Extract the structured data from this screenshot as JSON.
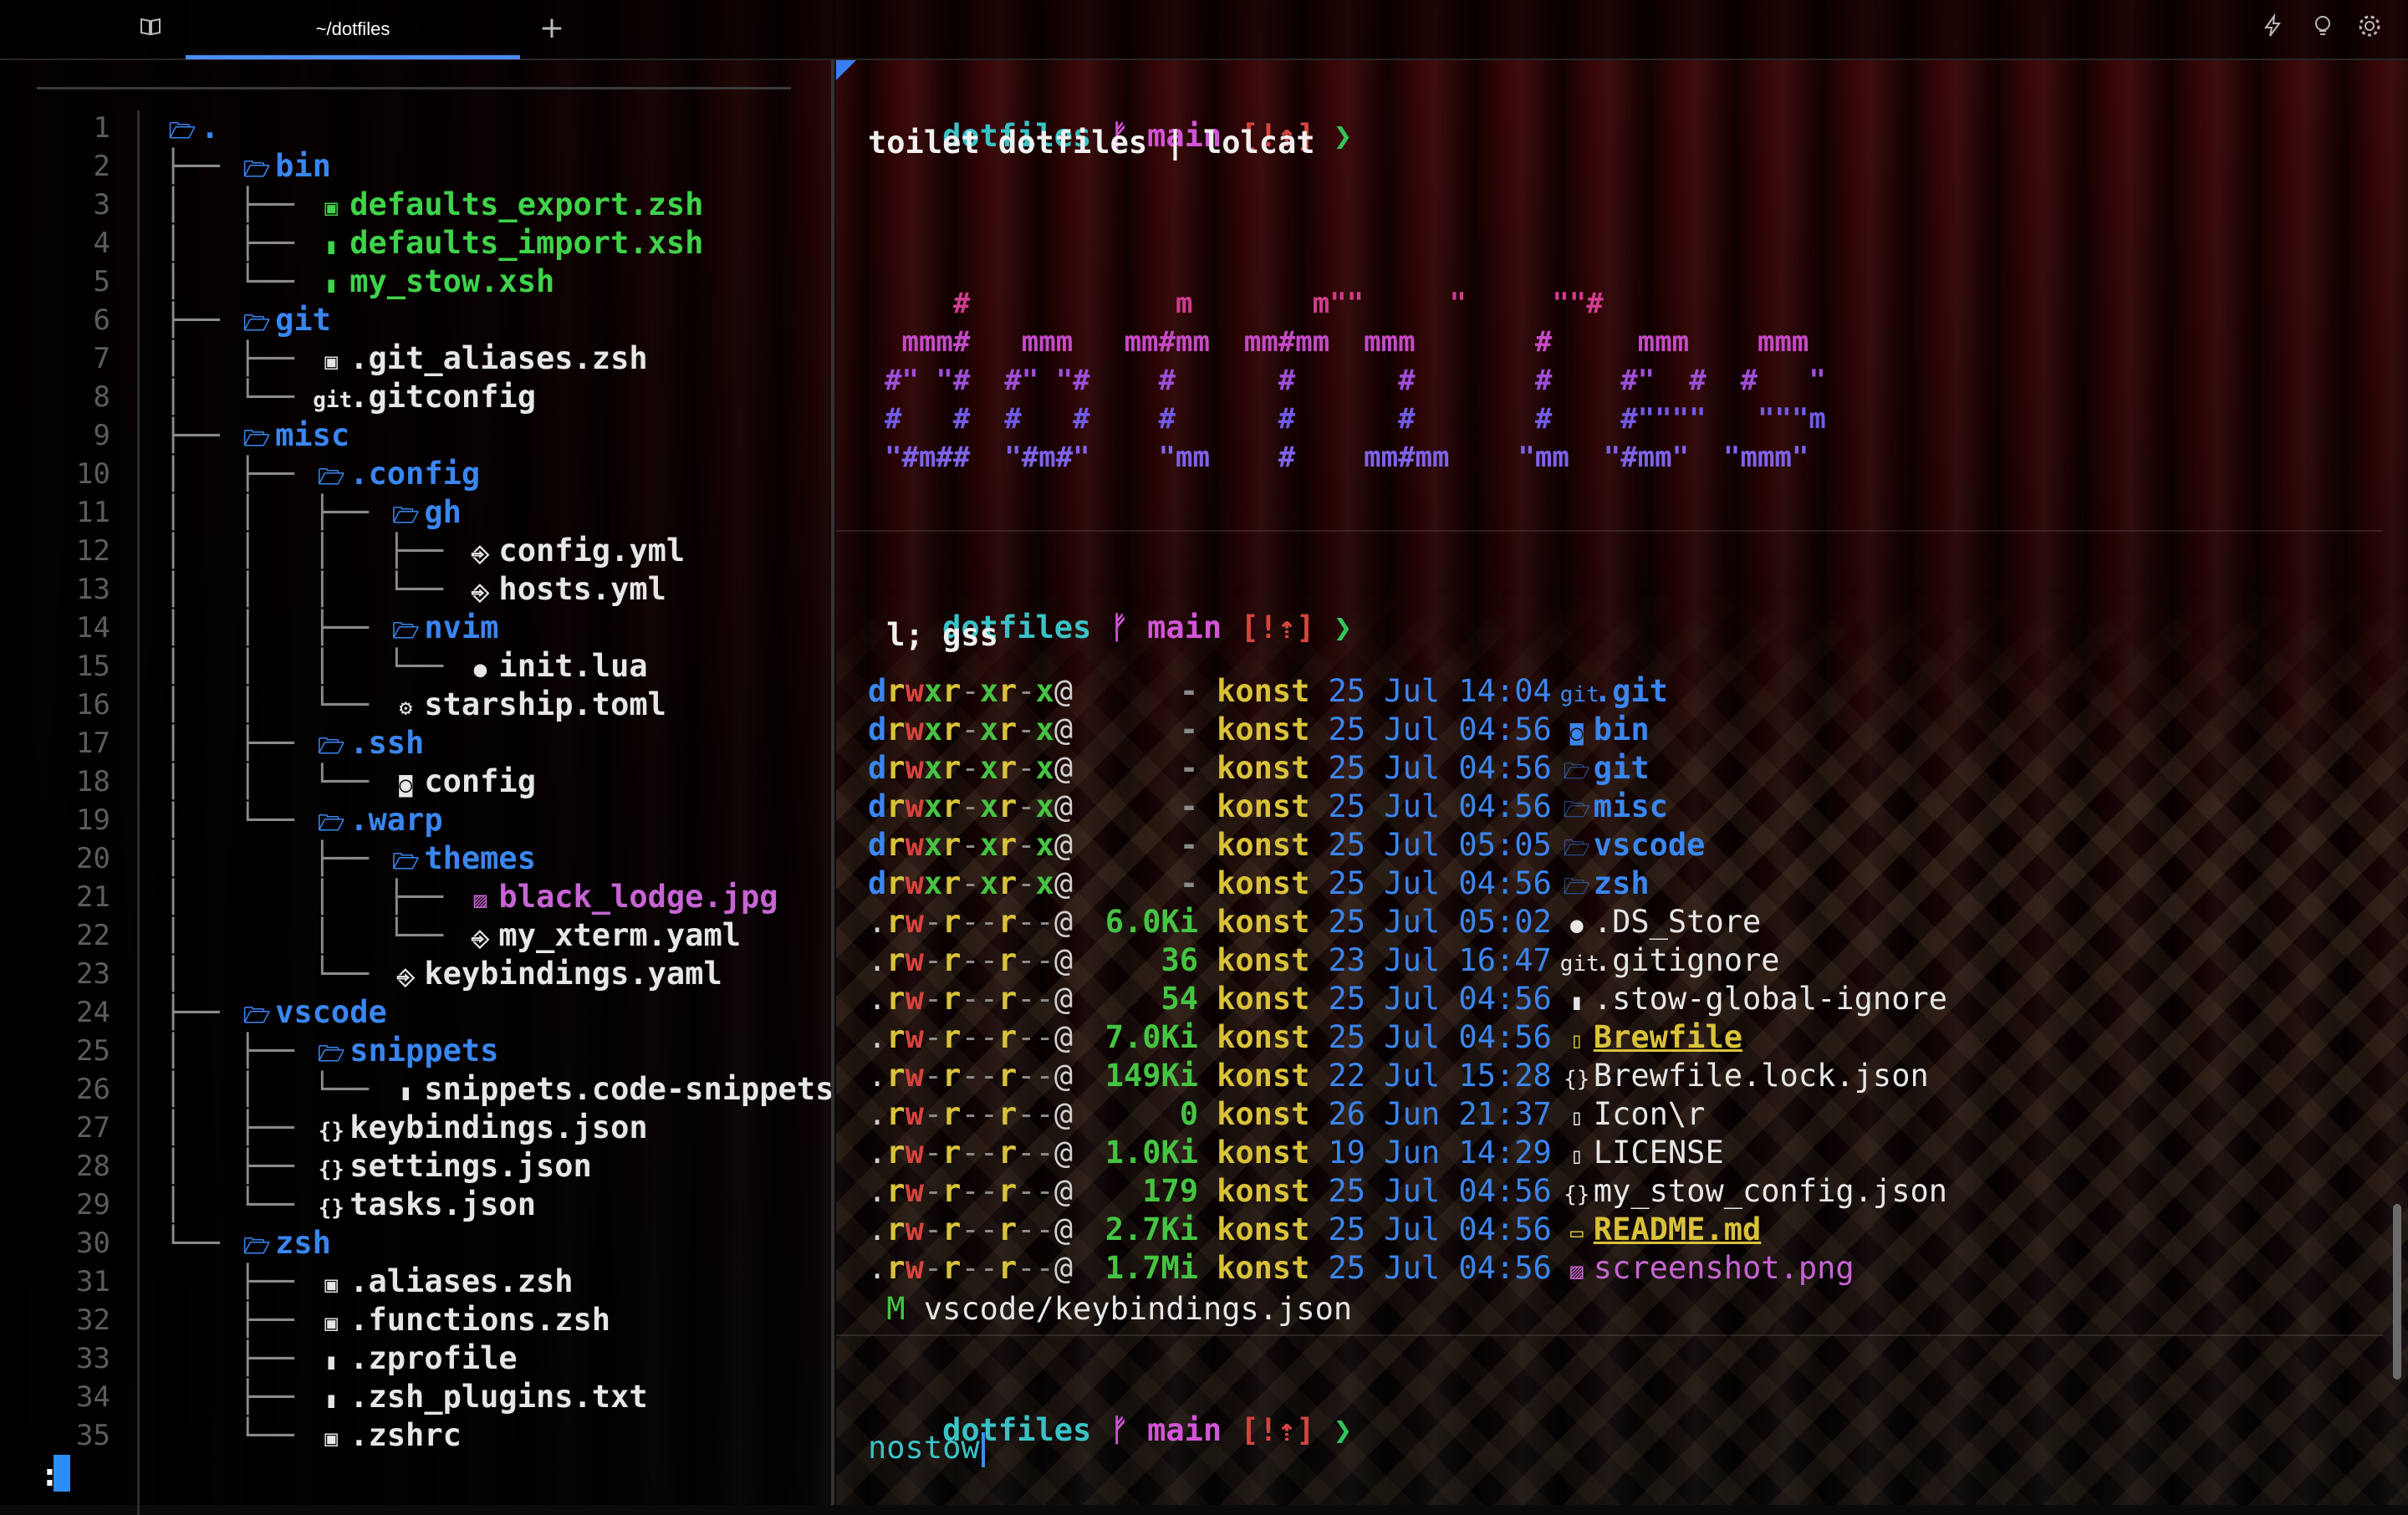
{
  "tabbar": {
    "tab_title": "~/dotfiles",
    "new_tab": "+",
    "icons": [
      "book-icon",
      "lightning-icon",
      "lightbulb-icon",
      "gear-icon"
    ]
  },
  "file_tree": {
    "mode_line": ":",
    "rows": [
      {
        "ln": "1",
        "prefix": "",
        "icon": "🗁",
        "name": ".",
        "color": "#3a86f0"
      },
      {
        "ln": "2",
        "prefix": "├── ",
        "icon": "🗁",
        "name": "bin",
        "color": "#3a86f0"
      },
      {
        "ln": "3",
        "prefix": "│   ├── ",
        "icon": "▣",
        "name": "defaults_export.zsh",
        "color": "#3fd34a"
      },
      {
        "ln": "4",
        "prefix": "│   ├── ",
        "icon": "▮",
        "name": "defaults_import.xsh",
        "color": "#3fd34a"
      },
      {
        "ln": "5",
        "prefix": "│   └── ",
        "icon": "▮",
        "name": "my_stow.xsh",
        "color": "#3fd34a"
      },
      {
        "ln": "6",
        "prefix": "├── ",
        "icon": "🗁",
        "name": "git",
        "color": "#3a86f0"
      },
      {
        "ln": "7",
        "prefix": "│   ├── ",
        "icon": "▣",
        "name": ".git_aliases.zsh",
        "color": "#e6e6e6"
      },
      {
        "ln": "8",
        "prefix": "│   └── ",
        "icon": "git",
        "name": ".gitconfig",
        "color": "#e6e6e6"
      },
      {
        "ln": "9",
        "prefix": "├── ",
        "icon": "🗁",
        "name": "misc",
        "color": "#3a86f0"
      },
      {
        "ln": "10",
        "prefix": "│   ├── ",
        "icon": "🗁",
        "name": ".config",
        "color": "#3a86f0"
      },
      {
        "ln": "11",
        "prefix": "│   │   ├── ",
        "icon": "🗁",
        "name": "gh",
        "color": "#3a86f0"
      },
      {
        "ln": "12",
        "prefix": "│   │   │   ├── ",
        "icon": "⎆",
        "name": "config.yml",
        "color": "#e6e6e6"
      },
      {
        "ln": "13",
        "prefix": "│   │   │   └── ",
        "icon": "⎆",
        "name": "hosts.yml",
        "color": "#e6e6e6"
      },
      {
        "ln": "14",
        "prefix": "│   │   ├── ",
        "icon": "🗁",
        "name": "nvim",
        "color": "#3a86f0"
      },
      {
        "ln": "15",
        "prefix": "│   │   │   └── ",
        "icon": "●",
        "name": "init.lua",
        "color": "#e6e6e6"
      },
      {
        "ln": "16",
        "prefix": "│   │   └── ",
        "icon": "⚙",
        "name": "starship.toml",
        "color": "#e6e6e6"
      },
      {
        "ln": "17",
        "prefix": "│   ├── ",
        "icon": "🗁",
        "name": ".ssh",
        "color": "#3a86f0"
      },
      {
        "ln": "18",
        "prefix": "│   │   └── ",
        "icon": "◙",
        "name": "config",
        "color": "#e6e6e6"
      },
      {
        "ln": "19",
        "prefix": "│   └── ",
        "icon": "🗁",
        "name": ".warp",
        "color": "#3a86f0"
      },
      {
        "ln": "20",
        "prefix": "│       ├── ",
        "icon": "🗁",
        "name": "themes",
        "color": "#3a86f0"
      },
      {
        "ln": "21",
        "prefix": "│       │   ├── ",
        "icon": "▨",
        "name": "black_lodge.jpg",
        "color": "#c764d4"
      },
      {
        "ln": "22",
        "prefix": "│       │   └── ",
        "icon": "⎆",
        "name": "my_xterm.yaml",
        "color": "#e6e6e6"
      },
      {
        "ln": "23",
        "prefix": "│       └── ",
        "icon": "⎆",
        "name": "keybindings.yaml",
        "color": "#e6e6e6"
      },
      {
        "ln": "24",
        "prefix": "├── ",
        "icon": "🗁",
        "name": "vscode",
        "color": "#3a86f0"
      },
      {
        "ln": "25",
        "prefix": "│   ├── ",
        "icon": "🗁",
        "name": "snippets",
        "color": "#3a86f0"
      },
      {
        "ln": "26",
        "prefix": "│   │   └── ",
        "icon": "▮",
        "name": "snippets.code-snippets",
        "color": "#e6e6e6"
      },
      {
        "ln": "27",
        "prefix": "│   ├── ",
        "icon": "{}",
        "name": "keybindings.json",
        "color": "#e6e6e6"
      },
      {
        "ln": "28",
        "prefix": "│   ├── ",
        "icon": "{}",
        "name": "settings.json",
        "color": "#e6e6e6"
      },
      {
        "ln": "29",
        "prefix": "│   └── ",
        "icon": "{}",
        "name": "tasks.json",
        "color": "#e6e6e6"
      },
      {
        "ln": "30",
        "prefix": "└── ",
        "icon": "🗁",
        "name": "zsh",
        "color": "#3a86f0"
      },
      {
        "ln": "31",
        "prefix": "    ├── ",
        "icon": "▣",
        "name": ".aliases.zsh",
        "color": "#e6e6e6"
      },
      {
        "ln": "32",
        "prefix": "    ├── ",
        "icon": "▣",
        "name": ".functions.zsh",
        "color": "#e6e6e6"
      },
      {
        "ln": "33",
        "prefix": "    ├── ",
        "icon": "▮",
        "name": ".zprofile",
        "color": "#e6e6e6"
      },
      {
        "ln": "34",
        "prefix": "    ├── ",
        "icon": "▮",
        "name": ".zsh_plugins.txt",
        "color": "#e6e6e6"
      },
      {
        "ln": "35",
        "prefix": "    └── ",
        "icon": "▣",
        "name": ".zshrc",
        "color": "#e6e6e6"
      }
    ]
  },
  "prompt": {
    "dir": "dotfiles",
    "branch_icon": "ᚠ",
    "branch": "main",
    "status": "[!⇡]",
    "arrow": "❯"
  },
  "block1": {
    "command": "toilet dotfiles | lolcat",
    "ascii_lines": [
      "    #            m       m\"\"     \"     \"\"#",
      " mmm#   mmm   mm#mm  mm#mm  mmm       #     mmm    mmm",
      "#\" \"#  #\" \"#    #      #      #       #    #\"  #  #   \"",
      "#   #  #   #    #      #      #       #    #\"\"\"\"   \"\"\"m",
      "\"#m##  \"#m#\"    \"mm    #    mm#mm    \"mm  \"#mm\"  \"mmm\""
    ],
    "ascii_colors": [
      "#d13c8e",
      "#c44ac6",
      "#9d4fd8",
      "#6f5be6",
      "#7d63e8"
    ]
  },
  "block2": {
    "command": " l; gss",
    "ls_rows": [
      {
        "perm": "drwxr-xr-x@",
        "size": "-",
        "user": "konst",
        "date": "25 Jul 14:04",
        "icon": "git",
        "name": ".git",
        "kind": "dir"
      },
      {
        "perm": "drwxr-xr-x@",
        "size": "-",
        "user": "konst",
        "date": "25 Jul 04:56",
        "icon": "◙",
        "name": "bin",
        "kind": "dir"
      },
      {
        "perm": "drwxr-xr-x@",
        "size": "-",
        "user": "konst",
        "date": "25 Jul 04:56",
        "icon": "🗁",
        "name": "git",
        "kind": "dir"
      },
      {
        "perm": "drwxr-xr-x@",
        "size": "-",
        "user": "konst",
        "date": "25 Jul 04:56",
        "icon": "🗁",
        "name": "misc",
        "kind": "dir"
      },
      {
        "perm": "drwxr-xr-x@",
        "size": "-",
        "user": "konst",
        "date": "25 Jul 05:05",
        "icon": "🗁",
        "name": "vscode",
        "kind": "dir"
      },
      {
        "perm": "drwxr-xr-x@",
        "size": "-",
        "user": "konst",
        "date": "25 Jul 04:56",
        "icon": "🗁",
        "name": "zsh",
        "kind": "dir"
      },
      {
        "perm": ".rw-r--r--@",
        "size": "6.0Ki",
        "user": "konst",
        "date": "25 Jul 05:02",
        "icon": "●",
        "name": ".DS_Store",
        "kind": "file"
      },
      {
        "perm": ".rw-r--r--@",
        "size": "36",
        "user": "konst",
        "date": "23 Jul 16:47",
        "icon": "git",
        "name": ".gitignore",
        "kind": "file"
      },
      {
        "perm": ".rw-r--r--@",
        "size": "54",
        "user": "konst",
        "date": "25 Jul 04:56",
        "icon": "▮",
        "name": ".stow-global-ignore",
        "kind": "file"
      },
      {
        "perm": ".rw-r--r--@",
        "size": "7.0Ki",
        "user": "konst",
        "date": "25 Jul 04:56",
        "icon": "▯",
        "name": "Brewfile",
        "kind": "special"
      },
      {
        "perm": ".rw-r--r--@",
        "size": "149Ki",
        "user": "konst",
        "date": "22 Jul 15:28",
        "icon": "{}",
        "name": "Brewfile.lock.json",
        "kind": "file"
      },
      {
        "perm": ".rw-r--r--@",
        "size": "0",
        "user": "konst",
        "date": "26 Jun 21:37",
        "icon": "▯",
        "name": "Icon\\r",
        "kind": "file"
      },
      {
        "perm": ".rw-r--r--@",
        "size": "1.0Ki",
        "user": "konst",
        "date": "19 Jun 14:29",
        "icon": "▯",
        "name": "LICENSE",
        "kind": "file"
      },
      {
        "perm": ".rw-r--r--@",
        "size": "179",
        "user": "konst",
        "date": "25 Jul 04:56",
        "icon": "{}",
        "name": "my_stow_config.json",
        "kind": "file"
      },
      {
        "perm": ".rw-r--r--@",
        "size": "2.7Ki",
        "user": "konst",
        "date": "25 Jul 04:56",
        "icon": "▭",
        "name": "README.md",
        "kind": "special"
      },
      {
        "perm": ".rw-r--r--@",
        "size": "1.7Mi",
        "user": "konst",
        "date": "25 Jul 04:56",
        "icon": "▨",
        "name": "screenshot.png",
        "kind": "image"
      }
    ],
    "git_status": {
      "flag": "M",
      "path": "vscode/keybindings.json"
    }
  },
  "block3": {
    "input_value": "nostow"
  },
  "colors": {
    "dir": "#3a86f0",
    "user": "#d9c23a",
    "date": "#3a86f0",
    "size": "#45c442",
    "special": "#d9c23a",
    "image": "#c764d4"
  }
}
